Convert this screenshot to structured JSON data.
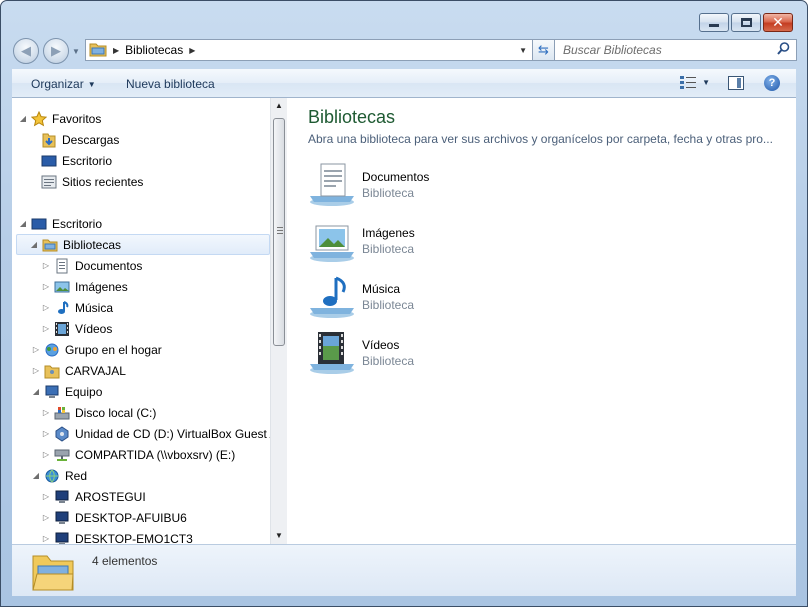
{
  "window": {
    "caption_buttons": {
      "minimize_icon": "minimize-icon",
      "maximize_icon": "maximize-icon",
      "close_icon": "close-icon"
    }
  },
  "address_bar": {
    "crumb": "Bibliotecas",
    "back_icon": "back-arrow-icon",
    "forward_icon": "forward-arrow-icon"
  },
  "search": {
    "placeholder": "Buscar Bibliotecas",
    "icon": "search-icon"
  },
  "toolbar": {
    "organize_label": "Organizar",
    "new_library_label": "Nueva biblioteca"
  },
  "nav_tree": {
    "favorites_label": "Favoritos",
    "downloads_label": "Descargas",
    "desktop_fav_label": "Escritorio",
    "recent_label": "Sitios recientes",
    "desktop_label": "Escritorio",
    "libraries_label": "Bibliotecas",
    "documents_label": "Documentos",
    "images_label": "Imágenes",
    "music_label": "Música",
    "videos_label": "Vídeos",
    "homegroup_label": "Grupo en el hogar",
    "user_label": "CARVAJAL",
    "computer_label": "Equipo",
    "local_disk_label": "Disco local (C:)",
    "cd_label": "Unidad de CD (D:) VirtualBox Guest Additions",
    "share_label": "COMPARTIDA (\\\\vboxsrv) (E:)",
    "network_label": "Red",
    "net_pc1_label": "AROSTEGUI",
    "net_pc2_label": "DESKTOP-AFUIBU6",
    "net_pc3_label": "DESKTOP-EMO1CT3"
  },
  "main": {
    "title": "Bibliotecas",
    "description": "Abra una biblioteca para ver sus archivos y organícelos por carpeta, fecha y otras pro...",
    "libraries": [
      {
        "name": "Documentos",
        "type": "Biblioteca"
      },
      {
        "name": "Imágenes",
        "type": "Biblioteca"
      },
      {
        "name": "Música",
        "type": "Biblioteca"
      },
      {
        "name": "Vídeos",
        "type": "Biblioteca"
      }
    ]
  },
  "details": {
    "count": "4 elementos"
  },
  "colors": {
    "title_green": "#1e5a32",
    "accent_blue": "#1e395b",
    "close_red": "#c43d22"
  }
}
